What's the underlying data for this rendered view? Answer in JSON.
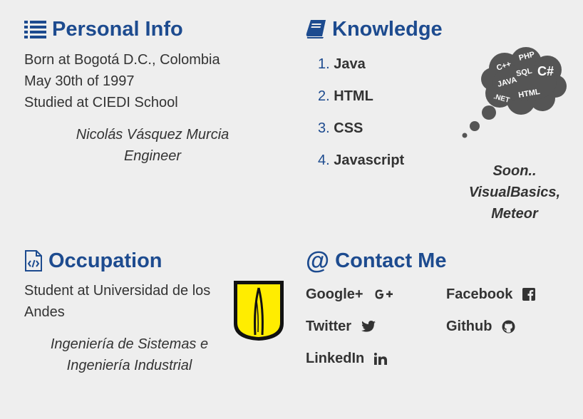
{
  "personal": {
    "title": "Personal Info",
    "icon": "list-icon",
    "lines": [
      "Born at Bogotá D.C., Colombia",
      "May 30th of 1997",
      "Studied at CIEDI School"
    ],
    "name": "Nicolás Vásquez Murcia",
    "role": "Engineer"
  },
  "knowledge": {
    "title": "Knowledge",
    "icon": "book-icon",
    "items": [
      {
        "num": "1.",
        "label": "Java"
      },
      {
        "num": "2.",
        "label": "HTML"
      },
      {
        "num": "3.",
        "label": "CSS"
      },
      {
        "num": "4.",
        "label": "Javascript"
      }
    ],
    "cloud_words": [
      "PHP",
      "C++",
      "SQL",
      "C#",
      "JAVA",
      ".NET",
      "HTML"
    ],
    "soon_lines": [
      "Soon..",
      "VisualBasics,",
      "Meteor"
    ]
  },
  "occupation": {
    "title": "Occupation",
    "icon": "code-file-icon",
    "line1": "Student at Universidad de los",
    "line2": "Andes",
    "degree_line1": "Ingeniería de Sistemas e",
    "degree_line2": "Ingeniería Industrial"
  },
  "contact": {
    "title": "Contact Me",
    "icon": "at-icon",
    "links": [
      {
        "label": "Google+",
        "icon": "google-plus-icon"
      },
      {
        "label": "Facebook",
        "icon": "facebook-icon"
      },
      {
        "label": "Twitter",
        "icon": "twitter-icon"
      },
      {
        "label": "Github",
        "icon": "github-icon"
      },
      {
        "label": "LinkedIn",
        "icon": "linkedin-icon"
      }
    ]
  },
  "colors": {
    "accent": "#1d4b8f",
    "background": "#eeeeee",
    "text": "#333333",
    "cloud": "#555555",
    "logo_yellow": "#ffed00"
  }
}
